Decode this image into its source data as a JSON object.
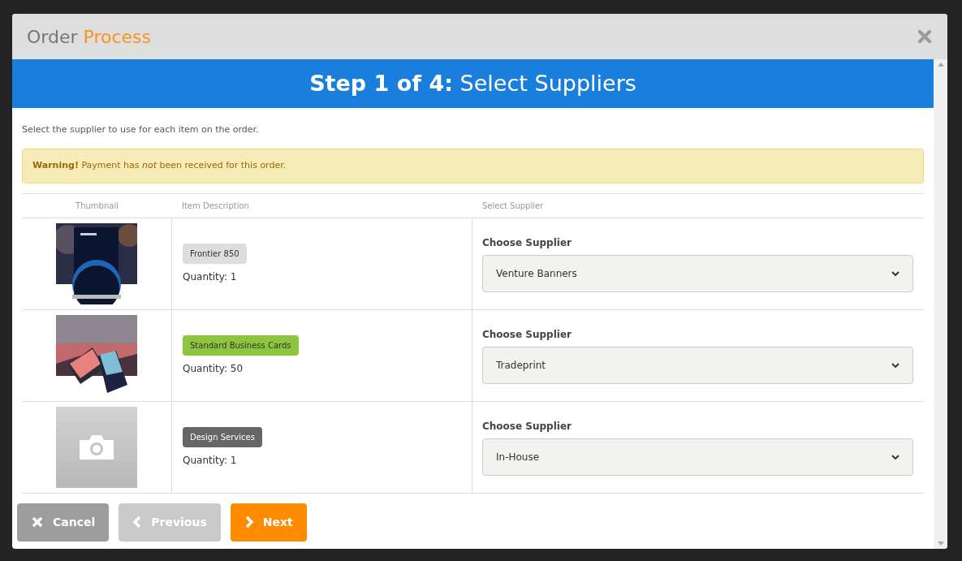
{
  "modal": {
    "title_lead": "Order",
    "title_accent": "Process",
    "step": {
      "label": "Step 1 of 4:",
      "name": "Select Suppliers"
    },
    "intro": "Select the supplier to use for each item on the order.",
    "warning": "**Warning!** Payment has *not* been received for this order.",
    "table": {
      "columns": [
        "Thumbnail",
        "Item Description",
        "Select Supplier"
      ],
      "rows": [
        {
          "tag": "Frontier 850",
          "color": "#dddddd",
          "quantity": "Quantity: 1",
          "supplier_label": "Choose Supplier",
          "supplier": "Venture Banners"
        },
        {
          "tag": "Standard Business Cards",
          "color": "#8cc63f",
          "quantity": "Quantity: 50",
          "supplier_label": "Choose Supplier",
          "supplier": "Tradeprint"
        },
        {
          "thumbnail": {
            "kind": "placeholder"
          },
          "tag": "Design Services",
          "color": "#666666",
          "quantity": "Quantity: 1",
          "supplier_label": "Choose Supplier",
          "supplier": "In-House"
        }
      ]
    },
    "buttons": [
      {
        "kind": "cancel",
        "label": "Cancel",
        "disabled": false
      },
      {
        "kind": "previous",
        "label": "Previous",
        "disabled": true
      },
      {
        "kind": "next",
        "label": "Next",
        "disabled": false
      }
    ]
  }
}
